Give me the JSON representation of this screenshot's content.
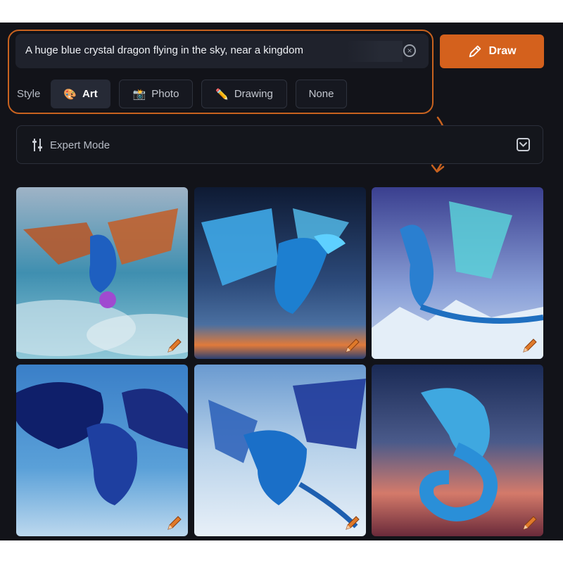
{
  "prompt": {
    "text": "A huge blue crystal dragon flying in the sky, near a kingdom",
    "clear_icon": "x-circle-icon"
  },
  "draw_button": {
    "label": "Draw",
    "icon": "pencil-icon",
    "color": "#d4611d"
  },
  "style": {
    "label": "Style",
    "options": [
      {
        "label": "Art",
        "emoji": "🎨",
        "active": true
      },
      {
        "label": "Photo",
        "emoji": "📸",
        "active": false
      },
      {
        "label": "Drawing",
        "emoji": "✏️",
        "active": false
      },
      {
        "label": "None",
        "emoji": "",
        "active": false
      }
    ]
  },
  "expert_mode": {
    "label": "Expert Mode",
    "icon": "sliders-icon",
    "toggle_icon": "chevron-down-icon"
  },
  "results": [
    {
      "desc": "dragon with orange wings in cloudy sky",
      "edit_icon": "pencil-icon"
    },
    {
      "desc": "crystal dragon over sunset clouds",
      "edit_icon": "pencil-icon"
    },
    {
      "desc": "crystal dragon over snowy mountains",
      "edit_icon": "pencil-icon"
    },
    {
      "desc": "dark blue dragon in storm",
      "edit_icon": "pencil-icon"
    },
    {
      "desc": "blue dragon in cloudy sky",
      "edit_icon": "pencil-icon"
    },
    {
      "desc": "coiled ice dragon in red sunset",
      "edit_icon": "pencil-icon"
    }
  ],
  "colors": {
    "accent": "#d4611d",
    "background": "#121319"
  }
}
